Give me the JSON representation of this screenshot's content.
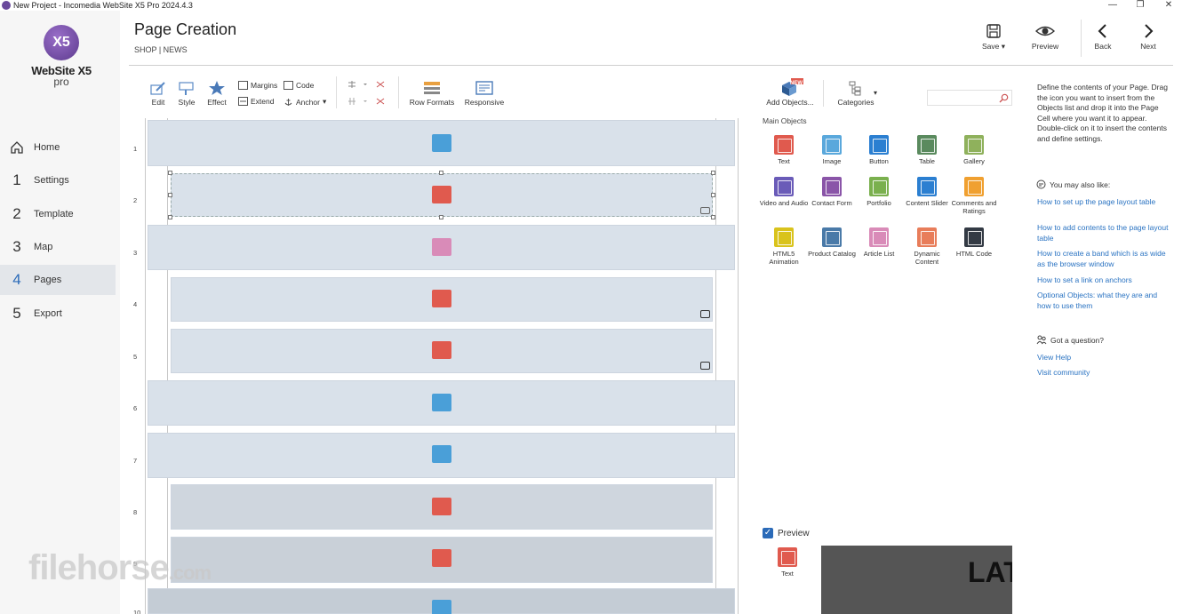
{
  "window": {
    "title": "New Project - Incomedia WebSite X5 Pro 2024.4.3",
    "minimize": "—",
    "maximize": "❐",
    "close": "✕"
  },
  "logo": {
    "mark": "X5",
    "brand": "WebSite X5",
    "edition": "pro"
  },
  "nav": [
    {
      "num": "",
      "label": "Home",
      "icon": "home-icon"
    },
    {
      "num": "1",
      "label": "Settings"
    },
    {
      "num": "2",
      "label": "Template"
    },
    {
      "num": "3",
      "label": "Map"
    },
    {
      "num": "4",
      "label": "Pages",
      "active": true
    },
    {
      "num": "5",
      "label": "Export"
    }
  ],
  "header": {
    "title": "Page Creation",
    "breadcrumb": "SHOP | NEWS",
    "save": "Save",
    "preview": "Preview",
    "back": "Back",
    "next": "Next"
  },
  "toolbar": {
    "edit": "Edit",
    "style": "Style",
    "effect": "Effect",
    "margins": "Margins",
    "extend": "Extend",
    "code": "Code",
    "anchor": "Anchor",
    "row_formats": "Row Formats",
    "responsive": "Responsive"
  },
  "canvas": {
    "rows": [
      "1",
      "2",
      "3",
      "4",
      "5",
      "6",
      "7",
      "8",
      "9",
      "10"
    ],
    "colors": {
      "text": "#e05a4e",
      "blue": "#4a9fd8",
      "pink": "#d98bb8",
      "band": "#d9e1ea"
    }
  },
  "objects_panel": {
    "add_objects": "Add Objects...",
    "new_badge": "NEW",
    "categories": "Categories",
    "main_objects": "Main Objects",
    "items": [
      {
        "label": "Text",
        "color": "#e05a4e"
      },
      {
        "label": "Image",
        "color": "#5aa8dc"
      },
      {
        "label": "Button",
        "color": "#2b7fd1"
      },
      {
        "label": "Table",
        "color": "#5a8a5e"
      },
      {
        "label": "Gallery",
        "color": "#8fb15c"
      },
      {
        "label": "Video and Audio",
        "color": "#6a5bb8"
      },
      {
        "label": "Contact Form",
        "color": "#8a55a8"
      },
      {
        "label": "Portfolio",
        "color": "#7ab04e"
      },
      {
        "label": "Content Slider",
        "color": "#2b7fd1"
      },
      {
        "label": "Comments and Ratings",
        "color": "#f0a030"
      },
      {
        "label": "HTML5 Animation",
        "color": "#d9c31c"
      },
      {
        "label": "Product Catalog",
        "color": "#4a7aa8"
      },
      {
        "label": "Article List",
        "color": "#d98bb8"
      },
      {
        "label": "Dynamic Content",
        "color": "#e87d5a"
      },
      {
        "label": "HTML Code",
        "color": "#333a44"
      }
    ]
  },
  "help": {
    "description": "Define the contents of your Page. Drag the icon you want to insert from the Objects list and drop it into the Page Cell where you want it to appear. Double-click on it to insert the contents and define settings.",
    "you_may_like": "You may also like:",
    "links": [
      "How to set up the page layout table",
      "How to add contents to the page layout table",
      "How to create a band which is as wide as the browser window",
      "How to set a link on anchors",
      "Optional Objects: what they are and how to use them"
    ],
    "question": "Got a question?",
    "help_links": [
      "View Help",
      "Visit community"
    ]
  },
  "preview": {
    "label": "Preview",
    "object": "Text",
    "sample": "LAT"
  },
  "watermark": {
    "main": "filehorse",
    "suffix": ".com"
  }
}
